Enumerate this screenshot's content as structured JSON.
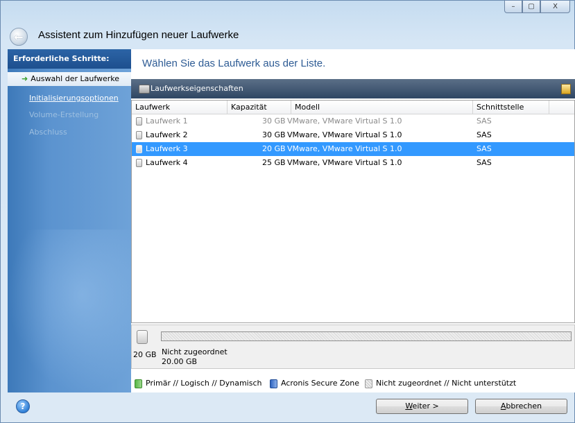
{
  "window": {
    "title": "Assistent zum Hinzufügen neuer Laufwerke",
    "controls": {
      "minimize": "–",
      "maximize": "▢",
      "close": "X"
    }
  },
  "sidebar": {
    "heading": "Erforderliche Schritte:",
    "items": [
      {
        "label": "Auswahl der Laufwerke",
        "state": "active"
      },
      {
        "label": "Initialisierungsoptionen",
        "state": "link"
      },
      {
        "label": "Volume-Erstellung",
        "state": "disabled"
      },
      {
        "label": "Abschluss",
        "state": "disabled"
      }
    ]
  },
  "main": {
    "title": "Wählen Sie das Laufwerk aus der Liste.",
    "toolbar_label": "Laufwerkseigenschaften",
    "columns": [
      "Laufwerk",
      "Kapazität",
      "Modell",
      "Schnittstelle"
    ],
    "rows": [
      {
        "name": "Laufwerk 1",
        "capacity": "30 GB",
        "model": "VMware, VMware Virtual S 1.0",
        "interface": "SAS",
        "state": "dim"
      },
      {
        "name": "Laufwerk 2",
        "capacity": "30 GB",
        "model": "VMware, VMware Virtual S 1.0",
        "interface": "SAS",
        "state": "normal"
      },
      {
        "name": "Laufwerk 3",
        "capacity": "20 GB",
        "model": "VMware, VMware Virtual S 1.0",
        "interface": "SAS",
        "state": "selected"
      },
      {
        "name": "Laufwerk 4",
        "capacity": "25 GB",
        "model": "VMware, VMware Virtual S 1.0",
        "interface": "SAS",
        "state": "normal"
      }
    ]
  },
  "disk_map": {
    "size": "20 GB",
    "partition_name": "Nicht zugeordnet",
    "partition_size": "20.00 GB"
  },
  "legend": {
    "primary": "Primär // Logisch // Dynamisch",
    "secure_zone": "Acronis Secure Zone",
    "unallocated": "Nicht zugeordnet // Nicht unterstützt"
  },
  "footer": {
    "help": "?",
    "next_underline": "W",
    "next_rest": "eiter >",
    "cancel_underline": "A",
    "cancel_rest": "bbrechen"
  },
  "colors": {
    "selection": "#3399ff",
    "title_text": "#2d5b94",
    "sidebar": "#4f8ac9"
  }
}
